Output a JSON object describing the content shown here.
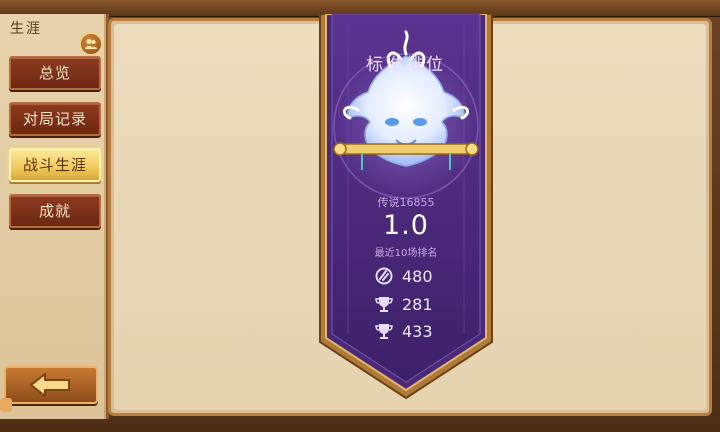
{
  "sidebar": {
    "title": "生涯",
    "items": [
      {
        "label": "总览"
      },
      {
        "label": "对局记录"
      },
      {
        "label": "战斗生涯"
      },
      {
        "label": "成就"
      }
    ],
    "active_index": 2
  },
  "banner": {
    "title": "标准排位",
    "rank_text": "传说16855",
    "score": "1.0",
    "score_caption": "最近10场排名",
    "stats": [
      {
        "icon": "medal-icon",
        "value": "480"
      },
      {
        "icon": "trophy-icon",
        "value": "281"
      },
      {
        "icon": "trophy-icon",
        "value": "433"
      }
    ]
  },
  "colors": {
    "banner_purple": "#4a2a78",
    "banner_border": "#c8934a",
    "active_button": "#f0c95a",
    "nav_button": "#7d3118"
  }
}
